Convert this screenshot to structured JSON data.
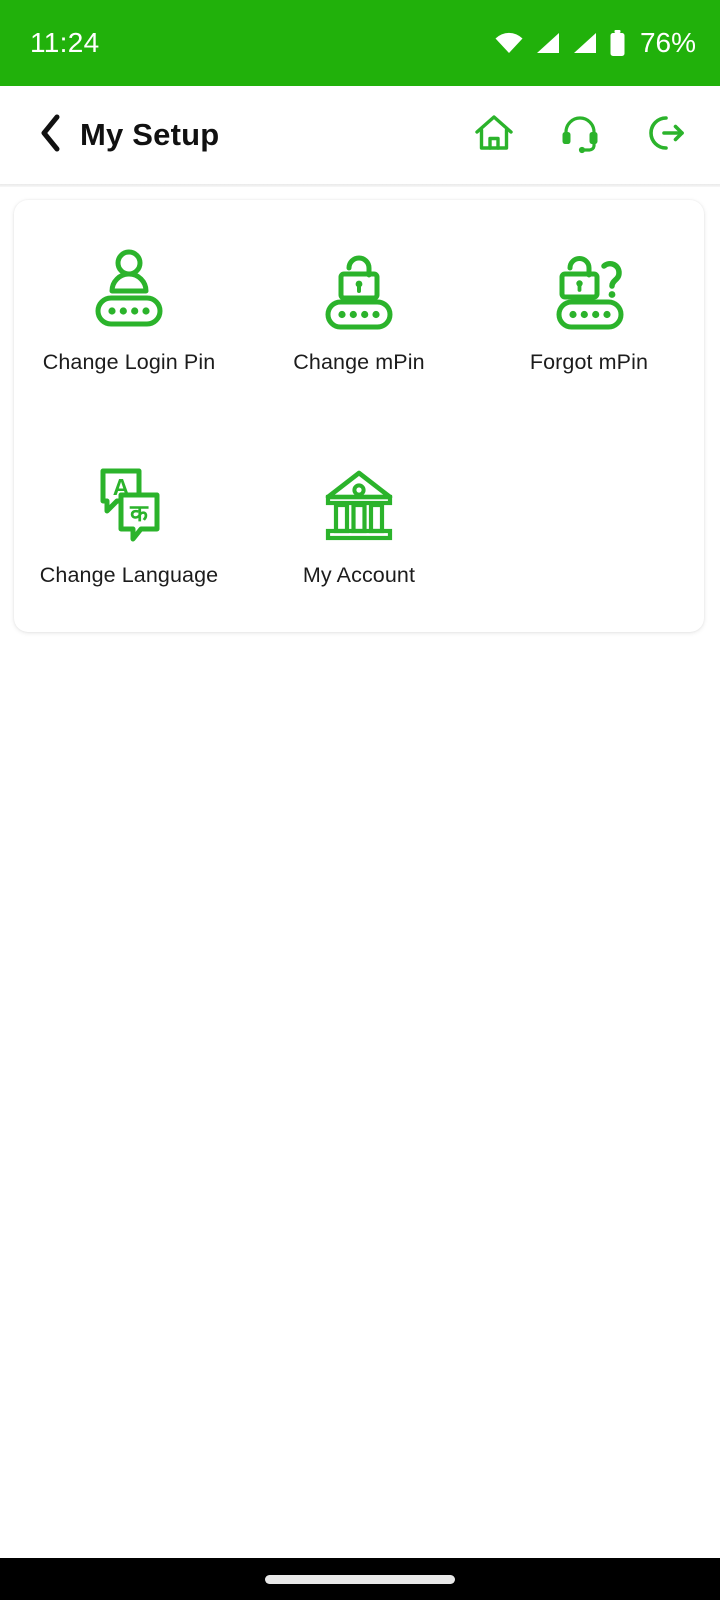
{
  "status_bar": {
    "time": "11:24",
    "battery_percent": "76%",
    "icons": [
      "wifi-icon",
      "signal-icon",
      "signal-icon",
      "battery-icon"
    ],
    "background_color": "#21b10b",
    "foreground_color": "#ffffff"
  },
  "app_bar": {
    "back_icon": "chevron-left-icon",
    "title": "My Setup",
    "actions": [
      {
        "icon": "home-icon",
        "label": "Home"
      },
      {
        "icon": "headset-icon",
        "label": "Customer Support"
      },
      {
        "icon": "logout-icon",
        "label": "Logout"
      }
    ],
    "accent_color": "#2bb32b",
    "title_color": "#111111"
  },
  "main": {
    "tiles": [
      {
        "id": "change-login-pin",
        "label": "Change Login Pin",
        "icon": "user-pin-icon"
      },
      {
        "id": "change-mpin",
        "label": "Change mPin",
        "icon": "lock-pin-icon"
      },
      {
        "id": "forgot-mpin",
        "label": "Forgot mPin",
        "icon": "lock-question-pin-icon"
      },
      {
        "id": "change-language",
        "label": "Change Language",
        "icon": "translate-icon"
      },
      {
        "id": "my-account",
        "label": "My Account",
        "icon": "bank-icon"
      }
    ],
    "icon_color": "#2bb32b",
    "label_color": "#1c1c1c",
    "card_background": "#ffffff"
  },
  "nav_bar": {
    "gesture_pill": "home-gesture-pill",
    "background_color": "#000000"
  }
}
